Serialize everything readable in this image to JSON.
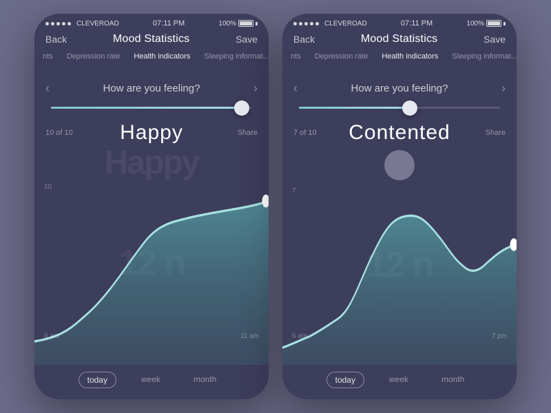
{
  "phones": [
    {
      "id": "phone1",
      "statusBar": {
        "carrier": "CLEVEROAD",
        "time": "07:11 PM",
        "battery": "100%"
      },
      "navBar": {
        "back": "Back",
        "title": "Mood Statistics",
        "save": "Save"
      },
      "tabs": [
        {
          "label": "nts",
          "active": false
        },
        {
          "label": "Depression rate",
          "active": false
        },
        {
          "label": "Health indicators",
          "active": true
        },
        {
          "label": "Sleeping informat...",
          "active": false
        }
      ],
      "question": "How  are you feeling?",
      "slider": {
        "fillPercent": 95,
        "thumbPercent": 95
      },
      "moodCount": "10 of 10",
      "moodLabel": "Happy",
      "moodShare": "Share",
      "chartLabelTop": "10",
      "chartBigNumber": "12 n",
      "chartTimeLeft": "6 am",
      "chartTimeRight": "11 am",
      "chartDotRight": 22,
      "chartDotBottom": 34,
      "watermark": "12 n",
      "showCircle": false,
      "bottomTabs": [
        {
          "label": "today",
          "active": true
        },
        {
          "label": "week",
          "active": false
        },
        {
          "label": "month",
          "active": false
        }
      ]
    },
    {
      "id": "phone2",
      "statusBar": {
        "carrier": "CLEVEROAD",
        "time": "07:11 PM",
        "battery": "100%"
      },
      "navBar": {
        "back": "Back",
        "title": "Mood Statistics",
        "save": "Save"
      },
      "tabs": [
        {
          "label": "nts",
          "active": false
        },
        {
          "label": "Depression rate",
          "active": false
        },
        {
          "label": "Health indicators",
          "active": true
        },
        {
          "label": "Sleeping informat...",
          "active": false
        }
      ],
      "question": "How  are you feeling?",
      "slider": {
        "fillPercent": 55,
        "thumbPercent": 55
      },
      "moodCount": "7  of 10",
      "moodLabel": "Contented",
      "moodShare": "Share",
      "chartLabelTop": "7",
      "chartBigNumber": "12 n",
      "chartTimeLeft": "6 am",
      "chartTimeRight": "7 pm",
      "showCircle": true,
      "watermark": "12 n",
      "bottomTabs": [
        {
          "label": "today",
          "active": true
        },
        {
          "label": "week",
          "active": false
        },
        {
          "label": "month",
          "active": false
        }
      ]
    }
  ]
}
